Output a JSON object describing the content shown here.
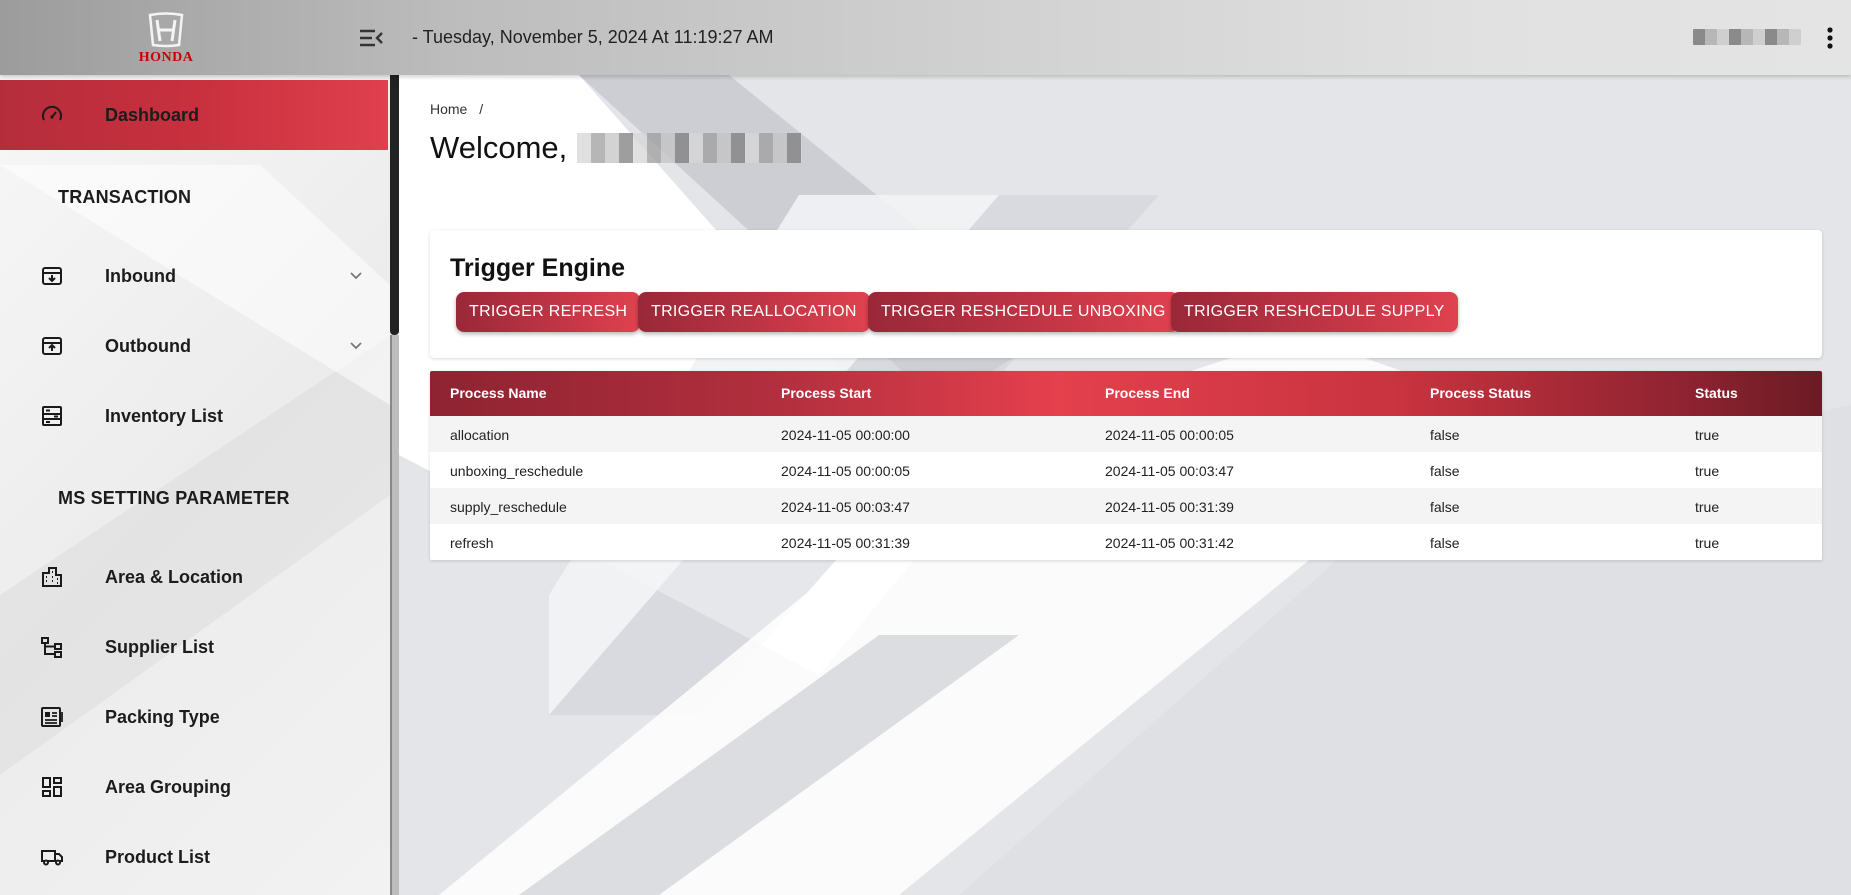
{
  "header": {
    "logo_text": "HONDA",
    "datetime": "- Tuesday, November 5, 2024 At 11:19:27 AM"
  },
  "sidebar": {
    "items": [
      {
        "label": "Dashboard",
        "icon": "dashboard-gauge-icon",
        "active": true
      },
      {
        "section": "TRANSACTION"
      },
      {
        "label": "Inbound",
        "icon": "inbox-download-icon",
        "expandable": true
      },
      {
        "label": "Outbound",
        "icon": "outbox-upload-icon",
        "expandable": true
      },
      {
        "label": "Inventory List",
        "icon": "inventory-icon"
      },
      {
        "section": "MS SETTING PARAMETER"
      },
      {
        "label": "Area & Location",
        "icon": "building-icon"
      },
      {
        "label": "Supplier List",
        "icon": "hierarchy-icon"
      },
      {
        "label": "Packing Type",
        "icon": "packing-list-icon"
      },
      {
        "label": "Area Grouping",
        "icon": "grid-dashboard-icon"
      },
      {
        "label": "Product List",
        "icon": "truck-icon"
      }
    ]
  },
  "breadcrumb": {
    "home": "Home",
    "separator": "/"
  },
  "welcome": {
    "text": "Welcome,"
  },
  "trigger_engine": {
    "title": "Trigger Engine",
    "buttons": [
      "TRIGGER REFRESH",
      "TRIGGER REALLOCATION",
      "TRIGGER RESHCEDULE UNBOXING",
      "TRIGGER RESHCEDULE SUPPLY"
    ]
  },
  "process_table": {
    "columns": [
      "Process Name",
      "Process Start",
      "Process End",
      "Process Status",
      "Status"
    ],
    "rows": [
      [
        "allocation",
        "2024-11-05 00:00:00",
        "2024-11-05 00:00:05",
        "false",
        "true"
      ],
      [
        "unboxing_reschedule",
        "2024-11-05 00:00:05",
        "2024-11-05 00:03:47",
        "false",
        "true"
      ],
      [
        "supply_reschedule",
        "2024-11-05 00:03:47",
        "2024-11-05 00:31:39",
        "false",
        "true"
      ],
      [
        "refresh",
        "2024-11-05 00:31:39",
        "2024-11-05 00:31:42",
        "false",
        "true"
      ]
    ]
  },
  "colors": {
    "accent_red": "#e0404d",
    "dark_red": "#8e2331"
  }
}
